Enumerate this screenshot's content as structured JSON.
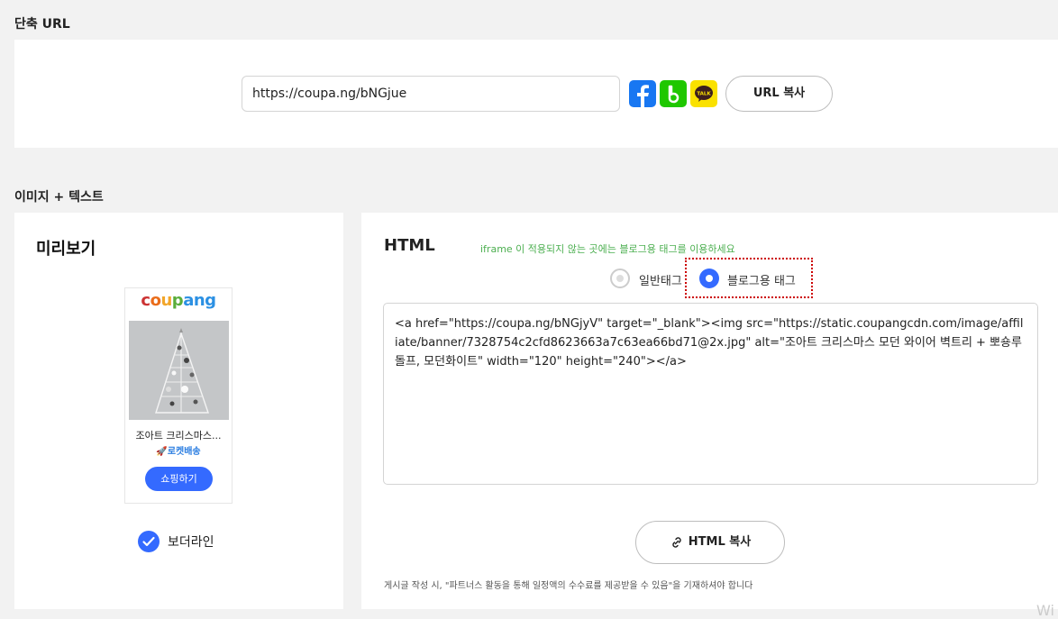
{
  "sections": {
    "short_url_title": "단축 URL",
    "image_text_title": "이미지 + 텍스트"
  },
  "short_url": {
    "value": "https://coupa.ng/bNGjue",
    "copy_label": "URL 복사"
  },
  "share_icons": [
    "facebook-icon",
    "band-icon",
    "kakaotalk-icon"
  ],
  "preview": {
    "title": "미리보기",
    "logo": [
      "c",
      "o",
      "u",
      "p",
      "a",
      "n",
      "g"
    ],
    "logo_colors": [
      "#c33",
      "#ea6d1b",
      "#f2a62a",
      "#5aad3b",
      "#2b90e3",
      "#2b90e3",
      "#2b90e3"
    ],
    "product_name": "조아트 크리스마스...",
    "rocket_label": "로켓배송",
    "shop_button": "쇼핑하기",
    "border_label": "보더라인",
    "border_checked": true
  },
  "html_panel": {
    "title": "HTML",
    "hint": "iframe 이 적용되지 않는 곳에는 블로그용 태그를 이용하세요",
    "radio_options": [
      "일반태그",
      "블로그용 태그"
    ],
    "selected_option": "블로그용 태그",
    "code": "<a href=\"https://coupa.ng/bNGjyV\" target=\"_blank\"><img src=\"https://static.coupangcdn.com/image/affiliate/banner/7328754c2cfd8623663a7c63ea66bd71@2x.jpg\" alt=\"조아트 크리스마스 모던 와이어 벽트리 + 뽀숑루돌프, 모던화이트\" width=\"120\" height=\"240\"></a>",
    "copy_label": "HTML 복사",
    "notice": "게시글 작성 시, \"파트너스 활동을 통해 일정액의 수수료를 제공받을 수 있음\"을 기재하셔야 합니다"
  },
  "watermark": "Wi",
  "colors": {
    "accent": "#346aff",
    "hint": "#4caf50",
    "highlight_border": "#cc0000"
  }
}
